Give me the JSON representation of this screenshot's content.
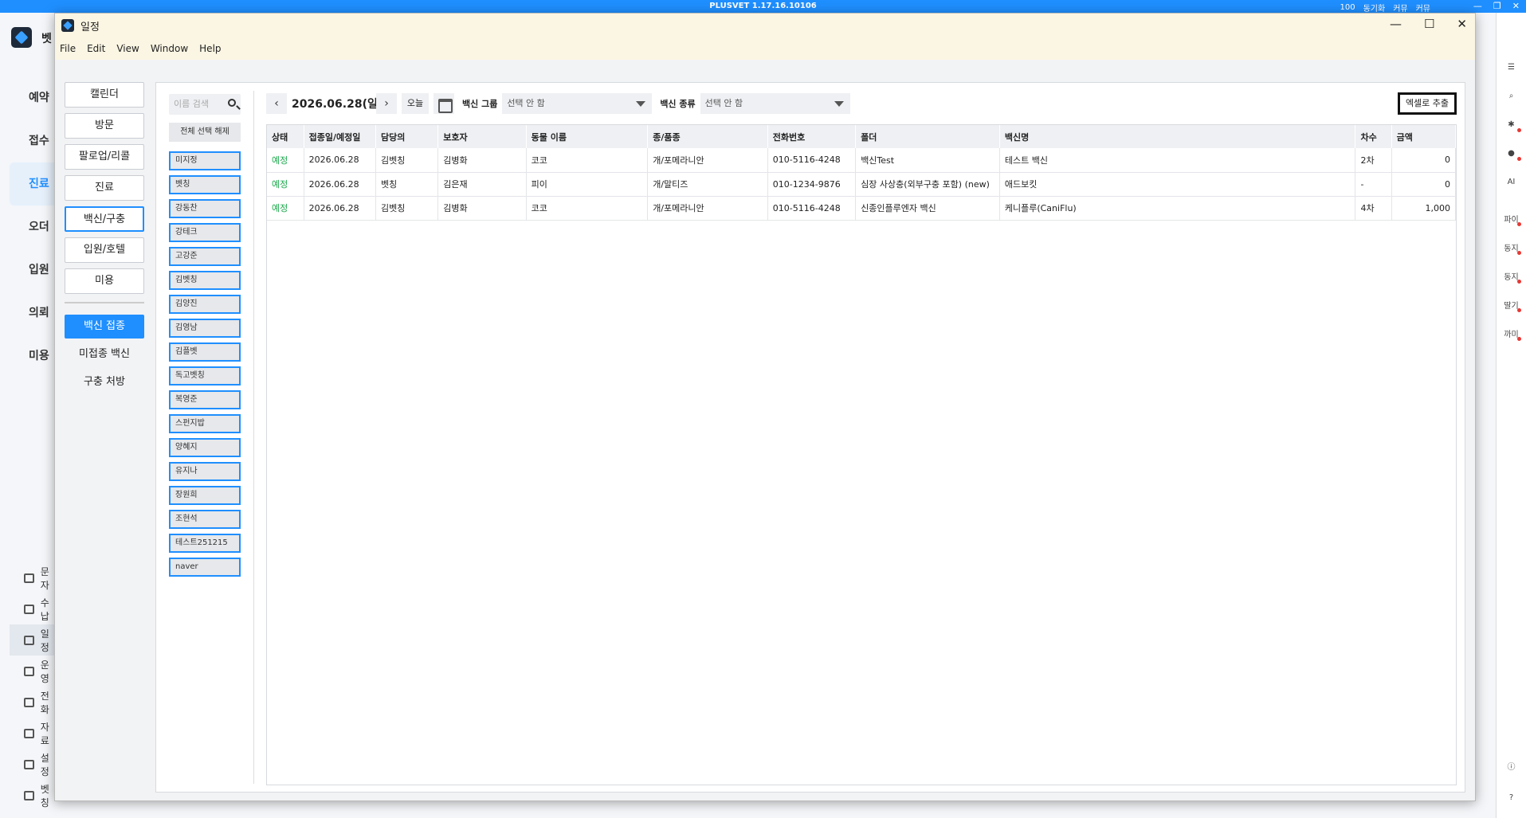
{
  "sysbar": {
    "version": "PLUSVET 1.17.16.10106",
    "zoom": "100",
    "sync": "동기화",
    "alarm": "커뮤",
    "call": "커뮤"
  },
  "bg_app": {
    "brand": "벳",
    "nav": [
      "예약",
      "접수",
      "진료",
      "오더",
      "입원",
      "의뢰",
      "미용"
    ],
    "active_nav": 2,
    "sub": [
      "문자",
      "수납",
      "일정",
      "운영",
      "전화",
      "자료",
      "설정",
      "벳칭"
    ],
    "rail": [
      "파이",
      "동지",
      "동지",
      "딸기",
      "까미"
    ]
  },
  "window": {
    "title": "일정",
    "menu": [
      "File",
      "Edit",
      "View",
      "Window",
      "Help"
    ]
  },
  "categories": [
    "캘린더",
    "방문",
    "팔로업/리콜",
    "진료",
    "백신/구충",
    "입원/호텔",
    "미용"
  ],
  "selected_category": 4,
  "subcategories": [
    "백신 접종",
    "미접종 백신",
    "구충 처방"
  ],
  "active_sub": 0,
  "staff": {
    "search_placeholder": "이름 검색",
    "deselect_all": "전체 선택 해제",
    "names": [
      "미지정",
      "벳칭",
      "강동찬",
      "강테크",
      "고강준",
      "김벳칭",
      "김양진",
      "김영남",
      "김플벳",
      "독고벳칭",
      "복영준",
      "스펀지밥",
      "양혜지",
      "유지나",
      "장원희",
      "조현석",
      "테스트251215",
      "naver"
    ]
  },
  "toolbar": {
    "date": "2026.06.28(일)",
    "today": "오늘",
    "vaccine_group_label": "백신 그룹",
    "vaccine_group_value": "선택 안 함",
    "vaccine_type_label": "백신 종류",
    "vaccine_type_value": "선택 안 함",
    "export": "엑셀로 추출"
  },
  "table": {
    "columns": [
      "상태",
      "접종일/예정일",
      "담당의",
      "보호자",
      "동물 이름",
      "종/품종",
      "전화번호",
      "폴더",
      "백신명",
      "차수",
      "금액"
    ],
    "rows": [
      [
        "예정",
        "2026.06.28",
        "김벳칭",
        "김병화",
        "코코",
        "개/포메라니안",
        "010-5116-4248",
        "백신Test",
        "테스트 백신",
        "2차",
        "0"
      ],
      [
        "예정",
        "2026.06.28",
        "벳칭",
        "김은재",
        "피이",
        "개/말티즈",
        "010-1234-9876",
        "심장 사상충(외부구충 포함) (new)",
        "애드보킷",
        "-",
        "0"
      ],
      [
        "예정",
        "2026.06.28",
        "김벳칭",
        "김병화",
        "코코",
        "개/포메라니안",
        "010-5116-4248",
        "신종인플루엔자 백신",
        "케니플루(CaniFlu)",
        "4차",
        "1,000"
      ]
    ]
  }
}
